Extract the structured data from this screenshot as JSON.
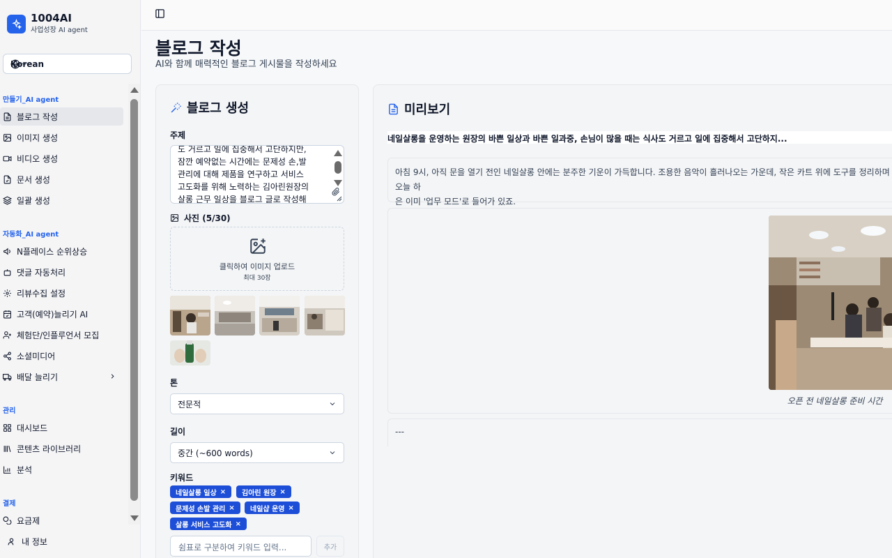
{
  "brand": {
    "name": "1004AI",
    "subtitle": "사업성장 AI agent"
  },
  "language": {
    "selected": "Korean"
  },
  "sidebar": {
    "sections": [
      {
        "label": "만들기_AI agent",
        "items": [
          "블로그 작성",
          "이미지 생성",
          "비디오 생성",
          "문서 생성",
          "일괄 생성"
        ]
      },
      {
        "label": "자동화_AI agent",
        "items": [
          "N플레이스 순위상승",
          "댓글 자동처리",
          "리뷰수집 설정",
          "고객(예약)늘리기 AI",
          "체험단/인플루언서 모집",
          "소셜미디어",
          "배달 늘리기"
        ]
      },
      {
        "label": "관리",
        "items": [
          "대시보드",
          "콘텐츠 라이브러리",
          "분석"
        ]
      },
      {
        "label": "결제",
        "items": [
          "요금제"
        ]
      }
    ],
    "active_item": "블로그 작성",
    "user_label": "내 정보"
  },
  "page": {
    "title": "블로그 작성",
    "subtitle": "AI와 함께 매력적인 블로그 게시물을 작성하세요"
  },
  "form": {
    "title": "블로그 생성",
    "topic_label": "주제",
    "topic_value": "도 거르고 일에 집중해서 고단하지만,\n잠깐 예약없는 시간에는 문제성 손,발\n관리에 대해 제품을 연구하고 서비스\n고도화를 위해 노력하는 김아린원장의\n살롱 근무 일상을 블로그 글로 작성해",
    "photos_label": "사진 (5/30)",
    "upload_text": "클릭하여 이미지 업로드",
    "upload_limit": "최대 30장",
    "tone_label": "톤",
    "tone_value": "전문적",
    "length_label": "길이",
    "length_value": "중간 (~600 words)",
    "keywords_label": "키워드",
    "keywords": [
      "네일살롱 일상",
      "김아린 원장",
      "문제성 손발 관리",
      "네일샵 운영",
      "살롱 서비스 고도화"
    ],
    "keyword_placeholder": "쉼표로 구분하여 키워드 입력...",
    "add_label": "추가"
  },
  "preview": {
    "title": "미리보기",
    "headline": "네일살롱을 운영하는 원장의 바쁜 일상과 바쁜 일과중, 손님이 많을 때는 식사도 거르고 일에 집중해서 고단하지...",
    "paragraph": "아침 9시, 아직 문을 열기 전인 네일살롱 안에는 분주한 기운이 가득합니다. 조용한 음악이 흘러나오는 가운데, 작은 카트 위에 도구를 정리하며 오늘 하\n은 이미 '업무 모드'로 들어가 있죠.",
    "image_caption": "오픈 전 네일살롱 준비 시간",
    "separator": "---"
  },
  "colors": {
    "accent": "#2563eb",
    "chip": "#1d4ed8"
  }
}
